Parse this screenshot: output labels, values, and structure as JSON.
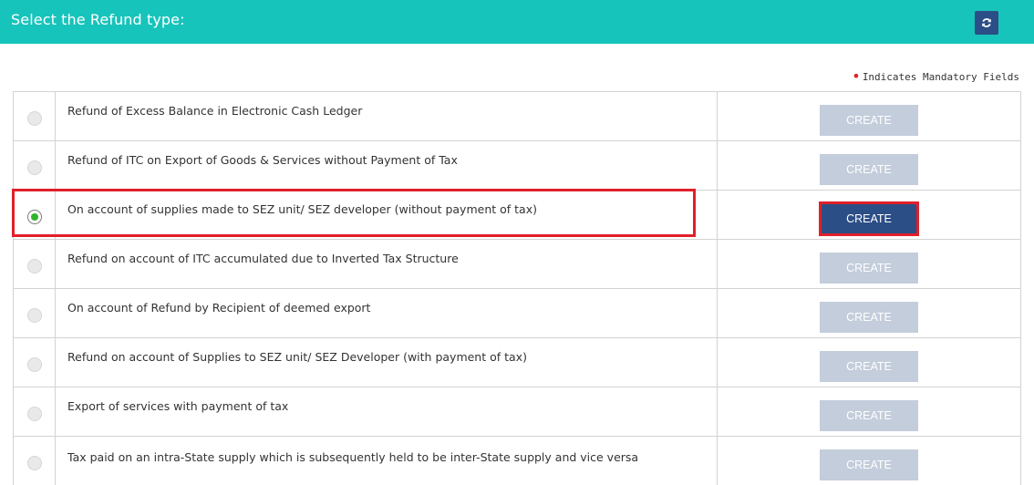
{
  "header": {
    "title": "Select the Refund type:",
    "refresh_icon": "refresh-icon",
    "bg_color": "#17c4bb"
  },
  "mandatory_note": "Indicates Mandatory Fields",
  "refund_options": [
    {
      "label": "Refund of Excess Balance in Electronic Cash Ledger",
      "selected": false,
      "button": "CREATE",
      "enabled": false
    },
    {
      "label": "Refund of ITC on Export of Goods & Services without Payment of Tax",
      "selected": false,
      "button": "CREATE",
      "enabled": false
    },
    {
      "label": "On account of supplies made to SEZ unit/ SEZ developer (without payment of tax)",
      "selected": true,
      "button": "CREATE",
      "enabled": true
    },
    {
      "label": "Refund on account of ITC accumulated due to Inverted Tax Structure",
      "selected": false,
      "button": "CREATE",
      "enabled": false
    },
    {
      "label": "On account of Refund by Recipient of deemed export",
      "selected": false,
      "button": "CREATE",
      "enabled": false
    },
    {
      "label": "Refund on account of Supplies to SEZ unit/ SEZ Developer (with payment of tax)",
      "selected": false,
      "button": "CREATE",
      "enabled": false
    },
    {
      "label": "Export of services with payment of tax",
      "selected": false,
      "button": "CREATE",
      "enabled": false
    },
    {
      "label": "Tax paid on an intra-State supply which is subsequently held to be inter-State supply and vice versa",
      "selected": false,
      "button": "CREATE",
      "enabled": false
    }
  ],
  "colors": {
    "accent": "#17c4bb",
    "primary_button": "#2c4e86",
    "disabled_button": "#c3cddb",
    "highlight": "#e0202a",
    "radio_checked": "#2fb52a"
  }
}
